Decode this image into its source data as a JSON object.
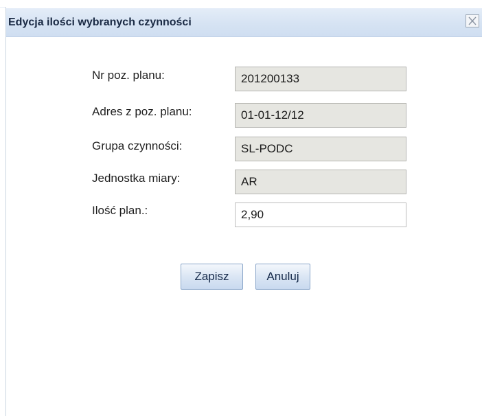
{
  "dialog": {
    "title": "Edycja ilości wybranych czynności",
    "close_icon": "close-icon"
  },
  "form": {
    "fields": [
      {
        "label": "Nr poz. planu:",
        "value": "201200133",
        "readonly": true
      },
      {
        "label": "Adres z poz. planu:",
        "value": "01-01-12/12",
        "readonly": true
      },
      {
        "label": "Grupa czynności:",
        "value": "SL-PODC",
        "readonly": true
      },
      {
        "label": "Jednostka miary:",
        "value": "AR",
        "readonly": true
      },
      {
        "label": "Ilość plan.:",
        "value": "2,90",
        "readonly": false
      }
    ]
  },
  "buttons": {
    "save_label": "Zapisz",
    "cancel_label": "Anuluj"
  },
  "colors": {
    "titlebar": "#d6e3f3",
    "readonly_field": "#e6e6e1",
    "button": "#dbe6f4"
  }
}
